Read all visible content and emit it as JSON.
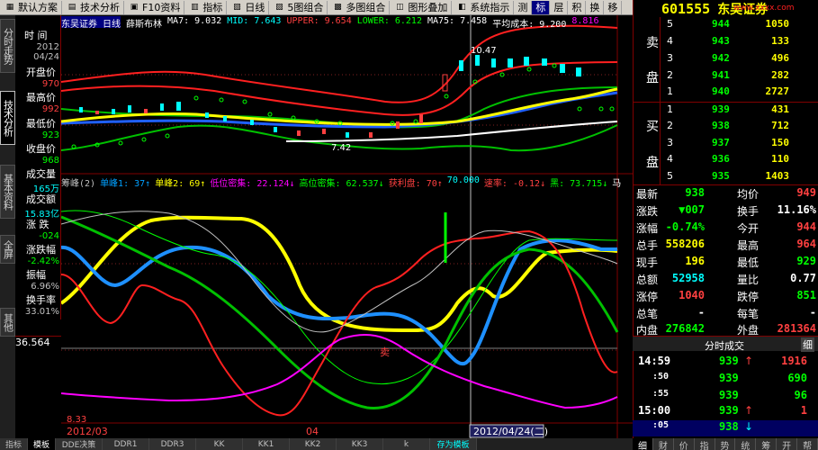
{
  "menu": {
    "items": [
      "默认方案",
      "技术分析",
      "F10资料",
      "指标",
      "日线",
      "5图组合",
      "多图组合",
      "图形叠加",
      "系统指示",
      "测",
      "标",
      "层",
      "积",
      "换",
      "移"
    ],
    "selected": "标"
  },
  "stock": {
    "code": "601555",
    "name": "东吴证券",
    "watermark": "www.xxxx.com"
  },
  "left_tabs": [
    "分时走势",
    "技术分析",
    "基本资料",
    "全屏",
    "其他"
  ],
  "info_panel": {
    "rows": [
      {
        "label": "时 间",
        "value": "2012"
      },
      {
        "label": "",
        "value": "04/24"
      },
      {
        "label": "开盘价",
        "value": "970"
      },
      {
        "label": "最高价",
        "value": "992"
      },
      {
        "label": "最低价",
        "value": "923"
      },
      {
        "label": "收盘价",
        "value": "968"
      },
      {
        "label": "成交量",
        "value": "165万"
      },
      {
        "label": "成交额",
        "value": "15.83亿"
      },
      {
        "label": "涨 跌",
        "value": "-024"
      },
      {
        "label": "涨跌幅",
        "value": "-2.42%"
      },
      {
        "label": "振幅",
        "value": "6.96%"
      },
      {
        "label": "换手率",
        "value": "33.01%"
      }
    ],
    "bottom_value": "36.564"
  },
  "main_chart_header": {
    "stock_label": "东吴证券 日线",
    "indicator": "薛斯布林",
    "items": [
      {
        "text": "MA7: 9.032",
        "color": "#ffffff"
      },
      {
        "text": "MID: 7.643",
        "color": "#00ffff"
      },
      {
        "text": "UPPER: 9.654",
        "color": "#ff4040"
      },
      {
        "text": "LOWER: 6.212",
        "color": "#00ff00"
      },
      {
        "text": "MA75: 7.458",
        "color": "#ffffff"
      },
      {
        "text": "平均成本: 9.200",
        "color": "#ffffff"
      },
      {
        "text": "8.816",
        "color": "#ff00ff"
      }
    ],
    "price_tags": [
      "10.47",
      "7.42"
    ]
  },
  "sub_chart_header": {
    "items": [
      {
        "text": "筹峰(2)",
        "color": "#c0c0c0"
      },
      {
        "text": "单峰1: 37↑",
        "color": "#00a0ff"
      },
      {
        "text": "单峰2: 69↑",
        "color": "#ffff00"
      },
      {
        "text": "低位密集: 22.124↓",
        "color": "#ff00ff"
      },
      {
        "text": "高位密集: 62.537↓",
        "color": "#00ff00"
      },
      {
        "text": "获利盘: 70↑",
        "color": "#ff4040"
      },
      {
        "text": "70.000",
        "color": "#00ffff"
      },
      {
        "text": "速率: -0.12↓",
        "color": "#ff4040"
      },
      {
        "text": "黑: 73.715↓",
        "color": "#00ff00"
      },
      {
        "text": "马",
        "color": "#ffffff"
      }
    ],
    "annotation": "卖",
    "bottom_left_value": "8.33"
  },
  "date_axis": {
    "left_label": "2012/03",
    "mid_label": "04",
    "cursor_label": "2012/04/24(二)"
  },
  "order_book": {
    "sell_label": [
      "卖",
      "盘"
    ],
    "buy_label": [
      "买",
      "盘"
    ],
    "asks": [
      {
        "level": "5",
        "price": "944",
        "volume": "1050"
      },
      {
        "level": "4",
        "price": "943",
        "volume": "133"
      },
      {
        "level": "3",
        "price": "942",
        "volume": "496"
      },
      {
        "level": "2",
        "price": "941",
        "volume": "282"
      },
      {
        "level": "1",
        "price": "940",
        "volume": "2727"
      }
    ],
    "bids": [
      {
        "level": "1",
        "price": "939",
        "volume": "431"
      },
      {
        "level": "2",
        "price": "938",
        "volume": "712"
      },
      {
        "level": "3",
        "price": "937",
        "volume": "150"
      },
      {
        "level": "4",
        "price": "936",
        "volume": "110"
      },
      {
        "level": "5",
        "price": "935",
        "volume": "1403"
      }
    ]
  },
  "quote": {
    "rows": [
      {
        "l1": "最新",
        "v1": "938",
        "c1": "#00ff00",
        "l2": "均价",
        "v2": "949",
        "c2": "#ff4040"
      },
      {
        "l1": "涨跌",
        "v1": "▼007",
        "c1": "#00ff00",
        "l2": "换手",
        "v2": "11.16%",
        "c2": "#ffffff"
      },
      {
        "l1": "涨幅",
        "v1": "-0.74%",
        "c1": "#00ff00",
        "l2": "今开",
        "v2": "944",
        "c2": "#ff4040"
      },
      {
        "l1": "总手",
        "v1": "558206",
        "c1": "#ffff00",
        "l2": "最高",
        "v2": "964",
        "c2": "#ff4040"
      },
      {
        "l1": "现手",
        "v1": "196",
        "c1": "#ffff00",
        "l2": "最低",
        "v2": "929",
        "c2": "#00ff00"
      },
      {
        "l1": "总额",
        "v1": "52958",
        "c1": "#00ffff",
        "l2": "量比",
        "v2": "0.77",
        "c2": "#ffffff"
      },
      {
        "l1": "涨停",
        "v1": "1040",
        "c1": "#ff4040",
        "l2": "跌停",
        "v2": "851",
        "c2": "#00ff00"
      },
      {
        "l1": "总笔",
        "v1": "-",
        "c1": "#ffffff",
        "l2": "每笔",
        "v2": "-",
        "c2": "#ffffff"
      },
      {
        "l1": "内盘",
        "v1": "276842",
        "c1": "#00ff00",
        "l2": "外盘",
        "v2": "281364",
        "c2": "#ff4040"
      }
    ]
  },
  "trades": {
    "title": "分时成交",
    "detail_btn": "细",
    "rows": [
      {
        "time": "14:59",
        "price": "939",
        "arrow": "↑",
        "vol": "1916",
        "pc": "#00ff00",
        "vc": "#ff4040"
      },
      {
        "time": ":50",
        "price": "939",
        "arrow": "",
        "vol": "690",
        "pc": "#00ff00",
        "vc": "#00ff00"
      },
      {
        "time": ":55",
        "price": "939",
        "arrow": "",
        "vol": "96",
        "pc": "#00ff00",
        "vc": "#00ff00"
      },
      {
        "time": "15:00",
        "price": "939",
        "arrow": "↑",
        "vol": "1",
        "pc": "#00ff00",
        "vc": "#ff4040"
      },
      {
        "time": ":05",
        "price": "938",
        "arrow": "↓",
        "vol": "",
        "pc": "#00ff00",
        "vc": "#00ff00"
      }
    ]
  },
  "bottom_tabs": [
    "指标",
    "模板",
    "DDE决策",
    "DDR1",
    "DDR3",
    "KK",
    "KK1",
    "KK2",
    "KK3",
    "k",
    "存为模板"
  ],
  "right_bottom_tabs": [
    "细",
    "财",
    "价",
    "指",
    "势",
    "统",
    "筹",
    "开",
    "帮"
  ]
}
